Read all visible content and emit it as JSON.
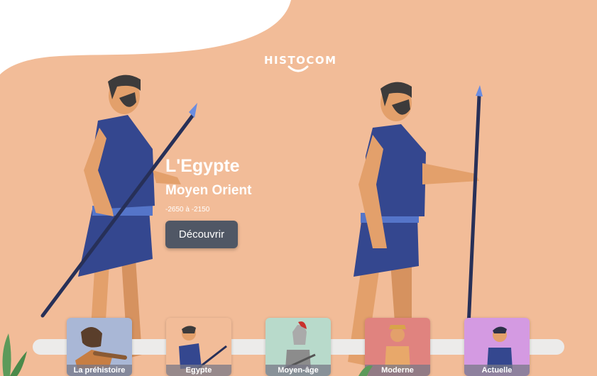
{
  "app": {
    "logo_text": "HISTOCOM"
  },
  "hero": {
    "title": "L'Egypte",
    "region": "Moyen Orient",
    "dates": "-2650 à -2150",
    "cta_label": "Découvrir"
  },
  "timeline": {
    "eras": [
      {
        "label": "La préhistoire",
        "color": "#a9b7d6"
      },
      {
        "label": "Egypte",
        "color": "#f2bc98"
      },
      {
        "label": "Moyen-âge",
        "color": "#b8dacb"
      },
      {
        "label": "Moderne",
        "color": "#e0837f"
      },
      {
        "label": "Actuelle",
        "color": "#d49ae2"
      }
    ]
  },
  "colors": {
    "background": "#f2bc98",
    "wave": "#ffffff",
    "tunic": "#34478f",
    "skin": "#e3a06b",
    "hair": "#3d3b3b",
    "spear": "#273058",
    "button": "#505765"
  }
}
